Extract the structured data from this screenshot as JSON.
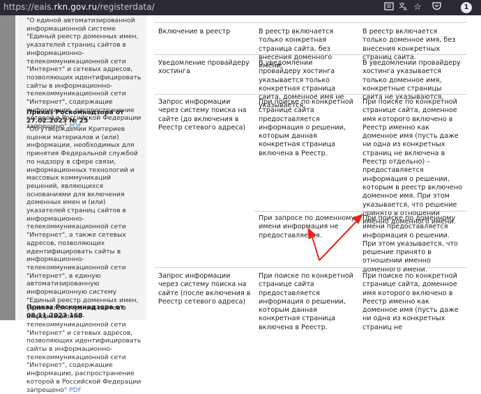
{
  "browser": {
    "url_prefix": "https://eais.",
    "url_domain": "rkn.gov.ru",
    "url_suffix": "/registerdata/",
    "icons": [
      "reader-view-icon",
      "translate-icon",
      "bookmark-star-icon",
      "pocket-icon",
      "profile-icon"
    ],
    "profile_letter": "1"
  },
  "sidebar": {
    "doc1_text": "\"О единой автоматизированной информационной системе \"Единый реестр доменных имен, указателей страниц сайтов в информационно-телекоммуникационной сети \"Интернет\" и сетевых адресов, позволяющих идентифицировать сайты в информационно-телекоммуникационной сети \"Интернет\", содержащие информацию, распространение которой в Российской Федерации запрещено\"",
    "doc2_title": "Приказ Роскомнадзора от 27.02.2023 № 25",
    "doc2_text": "\"Об утверждении Критериев оценки материалов и (или) информации, необходимых для принятия Федеральной службой по надзору в сфере связи, информационных технологий и массовых коммуникаций решений, являющихся основаниями для включения доменных имен и (или) указателей страниц сайтов в информационно-телекоммуникационной сети \"Интернет\", а также сетевых адресов, позволяющих идентифицировать сайты в информационно-телекоммуникационной сети \"Интернет\", в единую автоматизированную информационную систему \"Единый реестр доменных имен, указателей страниц сайтов в информационно-телекоммуникационной сети \"Интернет\" и сетевых адресов, позволяющих идентифицировать сайты в информационно-телекоммуникационной сети \"Интернет\", содержащие информацию, распространение которой в Российской Федерации запрещено\"",
    "pdf_label": "PDF",
    "doc3_title": "Приказ Роскомнадзора от 08.11.2023 168"
  },
  "table": {
    "rows": [
      {
        "c1": "Включение в реестр",
        "c2": "В реестр включается только конкретная страница сайта, без внесения доменного имени.",
        "c3": "В реестр включается только доменное имя, без внесения конкретных страниц сайта."
      },
      {
        "c1": "Уведомление провайдеру хостинга",
        "c2": "В уведомлении провайдеру хостинга указывается только конкретная страница сайта, доменное имя не указывается.",
        "c3": "В уведомлении провайдеру хостинга указывается только доменное имя, конкретные страницы сайта не указываются."
      },
      {
        "c1": "Запрос информации через систему поиска на сайте (до включения в Реестр сетевого адреса)",
        "c2": "При поиске по конкретной странице сайта предоставляется информация о решении, которым данная конкретная страница включена в Реестр.",
        "c3": "При поиске по конкретной странице сайта, доменное имя которого включено в Реестр именно как доменное имя (пусть даже ни одна из конкретных страниц не включена в Реестр отдельно) – предоставляется информация о решении, которым в реестр включено доменное имя. При этом указывается, что решение принято в отношении именно доменного имени."
      },
      {
        "c1": "",
        "c2": "При запросе по доменному имени информация не предоставляется.",
        "c3": "При поиске по доменному имени предоставляется информация о решении. При этом указывается, что решение принято в отношении именно доменного имени."
      },
      {
        "c1": "Запрос информации через систему поиска на сайте (после включения в Реестр сетевого адреса)",
        "c2": "При поиске по конкретной странице сайта предоставляется информация о решении, которым данная конкретная страница включена в Реестр.",
        "c3": "При поиске по конкретной странице сайта, доменное имя которого включено в Реестр именно как доменное имя (пусть даже ни одна из конкретных страниц не"
      }
    ]
  },
  "annotation": {
    "arrow_color": "#e8211e"
  }
}
